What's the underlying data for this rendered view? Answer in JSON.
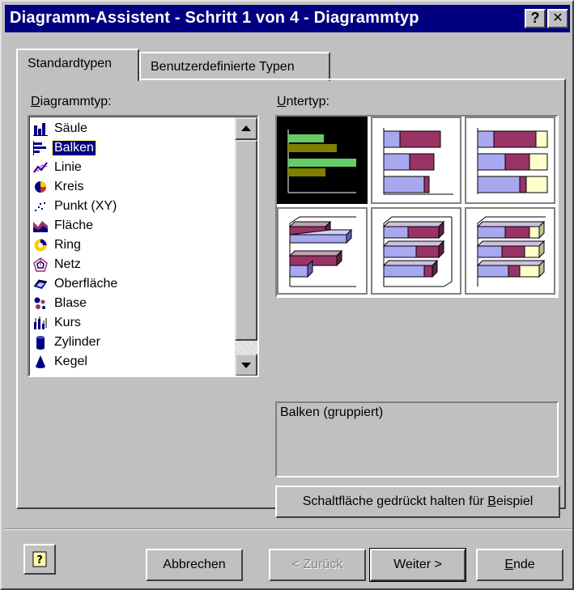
{
  "window": {
    "title": "Diagramm-Assistent - Schritt 1 von 4 - Diagrammtyp",
    "help_glyph": "?",
    "close_glyph": "✕"
  },
  "tabs": [
    {
      "label": "Standardtypen",
      "active": true
    },
    {
      "label": "Benutzerdefinierte Typen",
      "active": false
    }
  ],
  "chart_type": {
    "label_accel": "D",
    "label_rest": "iagrammtyp:",
    "items": [
      {
        "label": "Säule",
        "icon": "column-chart-icon"
      },
      {
        "label": "Balken",
        "icon": "bar-chart-icon",
        "selected": true
      },
      {
        "label": "Linie",
        "icon": "line-chart-icon"
      },
      {
        "label": "Kreis",
        "icon": "pie-chart-icon"
      },
      {
        "label": "Punkt (XY)",
        "icon": "scatter-chart-icon"
      },
      {
        "label": "Fläche",
        "icon": "area-chart-icon"
      },
      {
        "label": "Ring",
        "icon": "doughnut-chart-icon"
      },
      {
        "label": "Netz",
        "icon": "radar-chart-icon"
      },
      {
        "label": "Oberfläche",
        "icon": "surface-chart-icon"
      },
      {
        "label": "Blase",
        "icon": "bubble-chart-icon"
      },
      {
        "label": "Kurs",
        "icon": "stock-chart-icon"
      },
      {
        "label": "Zylinder",
        "icon": "cylinder-chart-icon"
      },
      {
        "label": "Kegel",
        "icon": "cone-chart-icon"
      }
    ]
  },
  "subtype": {
    "label_accel": "U",
    "label_rest": "ntertyp:",
    "options": [
      {
        "icon": "clustered-bar-icon",
        "selected": true
      },
      {
        "icon": "stacked-bar-icon"
      },
      {
        "icon": "100-stacked-bar-icon"
      },
      {
        "icon": "3d-clustered-bar-icon"
      },
      {
        "icon": "3d-stacked-bar-icon"
      },
      {
        "icon": "3d-100-stacked-bar-icon"
      }
    ],
    "description": "Balken (gruppiert)",
    "preview_button": {
      "prefix": "Schaltfläche gedrückt halten für ",
      "accel": "B",
      "rest": "eispiel"
    }
  },
  "footer": {
    "help_icon": "office-assistant-icon",
    "cancel": "Abbrechen",
    "back": "< Zurück",
    "next": "Weiter >",
    "finish_accel": "E",
    "finish_rest": "nde"
  },
  "colors": {
    "titlebar": "#000080",
    "face": "#c0c0c0",
    "bar_blue": "#a8a8f0",
    "bar_maroon": "#993366",
    "bar_cream": "#ffffcc",
    "bar_green": "#66cc66",
    "bar_olive": "#808000"
  }
}
